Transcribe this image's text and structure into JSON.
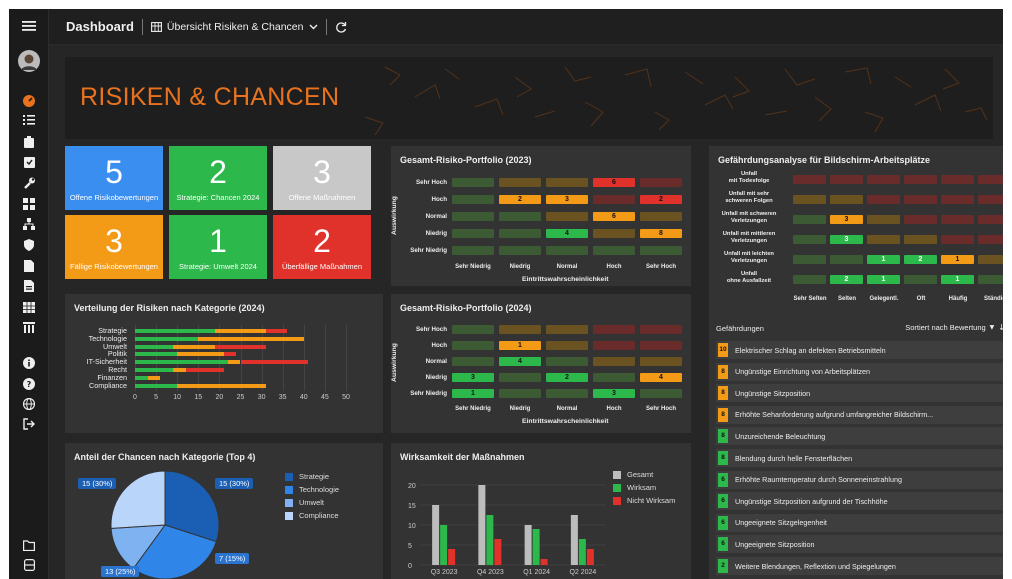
{
  "topbar": {
    "title": "Dashboard",
    "view_label": "Übersicht Risiken & Chancen"
  },
  "banner": {
    "title": "RISIKEN & CHANCEN"
  },
  "kpis": [
    {
      "value": "5",
      "label": "Offene Risikobewertungen",
      "color": "#3a8ef0"
    },
    {
      "value": "2",
      "label": "Strategie: Chancen 2024",
      "color": "#2db84b"
    },
    {
      "value": "3",
      "label": "Offene Maßnahmen",
      "color": "#c8c8c8"
    },
    {
      "value": "3",
      "label": "Fällige Risikobewertungen",
      "color": "#f39a16"
    },
    {
      "value": "1",
      "label": "Strategie: Umwelt 2024",
      "color": "#2db84b"
    },
    {
      "value": "2",
      "label": "Überfällige Maßnahmen",
      "color": "#e0312b"
    }
  ],
  "portfolio2023": {
    "title": "Gesamt-Risiko-Portfolio (2023)",
    "y_title": "Auswirkung",
    "x_title": "Eintrittswahrscheinlichkeit",
    "rows": [
      "Sehr Hoch",
      "Hoch",
      "Normal",
      "Niedrig",
      "Sehr Niedrig"
    ],
    "cols": [
      "Sehr Niedrig",
      "Niedrig",
      "Normal",
      "Hoch",
      "Sehr Hoch"
    ],
    "grid": [
      [
        {
          "v": "",
          "c": "#3c5a33"
        },
        {
          "v": "",
          "c": "#6a5320"
        },
        {
          "v": "",
          "c": "#6a5320"
        },
        {
          "v": "6",
          "c": "#e0312b"
        },
        {
          "v": "",
          "c": "#6a2c2a"
        }
      ],
      [
        {
          "v": "",
          "c": "#3c5a33"
        },
        {
          "v": "2",
          "c": "#f39a16"
        },
        {
          "v": "3",
          "c": "#f39a16"
        },
        {
          "v": "",
          "c": "#6a2c2a"
        },
        {
          "v": "2",
          "c": "#e0312b"
        }
      ],
      [
        {
          "v": "",
          "c": "#3c5a33"
        },
        {
          "v": "",
          "c": "#3c5a33"
        },
        {
          "v": "",
          "c": "#6a5320"
        },
        {
          "v": "6",
          "c": "#f39a16"
        },
        {
          "v": "",
          "c": "#6a5320"
        }
      ],
      [
        {
          "v": "",
          "c": "#3c5a33"
        },
        {
          "v": "",
          "c": "#3c5a33"
        },
        {
          "v": "4",
          "c": "#2db84b"
        },
        {
          "v": "",
          "c": "#6a5320"
        },
        {
          "v": "8",
          "c": "#f39a16"
        }
      ],
      [
        {
          "v": "",
          "c": "#3c5a33"
        },
        {
          "v": "",
          "c": "#3c5a33"
        },
        {
          "v": "",
          "c": "#3c5a33"
        },
        {
          "v": "",
          "c": "#3c5a33"
        },
        {
          "v": "",
          "c": "#3c5a33"
        }
      ]
    ]
  },
  "portfolio2024": {
    "title": "Gesamt-Risiko-Portfolio (2024)",
    "y_title": "Auswirkung",
    "x_title": "Eintrittswahrscheinlichkeit",
    "rows": [
      "Sehr Hoch",
      "Hoch",
      "Normal",
      "Niedrig",
      "Sehr Niedrig"
    ],
    "cols": [
      "Sehr Niedrig",
      "Niedrig",
      "Normal",
      "Hoch",
      "Sehr Hoch"
    ],
    "grid": [
      [
        {
          "v": "",
          "c": "#3c5a33"
        },
        {
          "v": "",
          "c": "#6a5320"
        },
        {
          "v": "",
          "c": "#6a5320"
        },
        {
          "v": "",
          "c": "#6a2c2a"
        },
        {
          "v": "",
          "c": "#6a2c2a"
        }
      ],
      [
        {
          "v": "",
          "c": "#3c5a33"
        },
        {
          "v": "1",
          "c": "#f39a16"
        },
        {
          "v": "",
          "c": "#6a5320"
        },
        {
          "v": "",
          "c": "#6a2c2a"
        },
        {
          "v": "",
          "c": "#6a2c2a"
        }
      ],
      [
        {
          "v": "",
          "c": "#3c5a33"
        },
        {
          "v": "4",
          "c": "#2db84b"
        },
        {
          "v": "",
          "c": "#3c5a33"
        },
        {
          "v": "",
          "c": "#6a5320"
        },
        {
          "v": "",
          "c": "#6a5320"
        }
      ],
      [
        {
          "v": "3",
          "c": "#2db84b"
        },
        {
          "v": "",
          "c": "#3c5a33"
        },
        {
          "v": "2",
          "c": "#2db84b"
        },
        {
          "v": "",
          "c": "#3c5a33"
        },
        {
          "v": "4",
          "c": "#f39a16"
        }
      ],
      [
        {
          "v": "1",
          "c": "#2db84b"
        },
        {
          "v": "",
          "c": "#3c5a33"
        },
        {
          "v": "",
          "c": "#3c5a33"
        },
        {
          "v": "3",
          "c": "#2db84b"
        },
        {
          "v": "",
          "c": "#3c5a33"
        }
      ]
    ]
  },
  "hazard": {
    "title": "Gefährdungsanalyse für Bildschirm-Arbeitsplätze",
    "rows": [
      "Unfall\nmit Todesfolge",
      "Unfall mit sehr\nschweren Folgen",
      "Unfall mit schweren\nVerletzungen",
      "Unfall mit mittleren\nVerletzungen",
      "Unfall mit leichten\nVerletzungen",
      "Unfall\nohne Ausfallzeit"
    ],
    "cols": [
      "Sehr Selten",
      "Selten",
      "Gelegentl.",
      "Oft",
      "Häufig",
      "Ständig"
    ],
    "grid": [
      [
        {
          "v": "",
          "c": "#6a2c2a"
        },
        {
          "v": "",
          "c": "#6a2c2a"
        },
        {
          "v": "",
          "c": "#6a2c2a"
        },
        {
          "v": "",
          "c": "#6a2c2a"
        },
        {
          "v": "",
          "c": "#6a2c2a"
        },
        {
          "v": "",
          "c": "#6a2c2a"
        }
      ],
      [
        {
          "v": "",
          "c": "#6a5320"
        },
        {
          "v": "",
          "c": "#6a5320"
        },
        {
          "v": "",
          "c": "#6a2c2a"
        },
        {
          "v": "",
          "c": "#6a2c2a"
        },
        {
          "v": "",
          "c": "#6a2c2a"
        },
        {
          "v": "",
          "c": "#6a2c2a"
        }
      ],
      [
        {
          "v": "",
          "c": "#3c5a33"
        },
        {
          "v": "3",
          "c": "#f39a16"
        },
        {
          "v": "",
          "c": "#6a5320"
        },
        {
          "v": "",
          "c": "#6a2c2a"
        },
        {
          "v": "",
          "c": "#6a2c2a"
        },
        {
          "v": "",
          "c": "#6a2c2a"
        }
      ],
      [
        {
          "v": "",
          "c": "#3c5a33"
        },
        {
          "v": "3",
          "c": "#2db84b"
        },
        {
          "v": "",
          "c": "#6a5320"
        },
        {
          "v": "",
          "c": "#6a5320"
        },
        {
          "v": "",
          "c": "#6a2c2a"
        },
        {
          "v": "",
          "c": "#6a2c2a"
        }
      ],
      [
        {
          "v": "",
          "c": "#3c5a33"
        },
        {
          "v": "",
          "c": "#3c5a33"
        },
        {
          "v": "1",
          "c": "#2db84b"
        },
        {
          "v": "2",
          "c": "#2db84b"
        },
        {
          "v": "1",
          "c": "#f39a16"
        },
        {
          "v": "",
          "c": "#6a5320"
        }
      ],
      [
        {
          "v": "",
          "c": "#3c5a33"
        },
        {
          "v": "2",
          "c": "#2db84b"
        },
        {
          "v": "1",
          "c": "#2db84b"
        },
        {
          "v": "",
          "c": "#3c5a33"
        },
        {
          "v": "1",
          "c": "#2db84b"
        },
        {
          "v": "",
          "c": "#3c5a33"
        }
      ]
    ]
  },
  "hazards_list": {
    "title": "Gefährdungen",
    "sort_label": "Sortiert nach Bewertung",
    "items": [
      {
        "score": "10",
        "label": "Elektrischer Schlag an defekten Betriebsmitteln",
        "color": "#f39a16"
      },
      {
        "score": "8",
        "label": "Ungünstige Einrichtung von Arbeitsplätzen",
        "color": "#f39a16"
      },
      {
        "score": "8",
        "label": "Ungünstige Sitzposition",
        "color": "#f39a16"
      },
      {
        "score": "8",
        "label": "Erhöhte Sehanforderung aufgrund umfangreicher Bildschirm...",
        "color": "#f39a16"
      },
      {
        "score": "8",
        "label": "Unzureichende Beleuchtung",
        "color": "#2db84b"
      },
      {
        "score": "8",
        "label": "Blendung durch helle Fensterflächen",
        "color": "#2db84b"
      },
      {
        "score": "6",
        "label": "Erhöhte Raumtemperatur durch Sonneneinstrahlung",
        "color": "#2db84b"
      },
      {
        "score": "6",
        "label": "Ungünstige Sitzposition aufgrund der Tischhöhe",
        "color": "#2db84b"
      },
      {
        "score": "6",
        "label": "Ungeeignete Sitzgelegenheit",
        "color": "#2db84b"
      },
      {
        "score": "6",
        "label": "Ungeeignete Sitzposition",
        "color": "#2db84b"
      },
      {
        "score": "2",
        "label": "Weitere Blendungen, Reflextion und Spiegelungen",
        "color": "#2db84b"
      }
    ]
  },
  "chart_data": [
    {
      "type": "bar",
      "orientation": "horizontal",
      "stacked": true,
      "title": "Verteilung der Risiken nach Kategorie (2024)",
      "categories": [
        "Strategie",
        "Technologie",
        "Umwelt",
        "Politik",
        "IT-Sicherheit",
        "Recht",
        "Finanzen",
        "Compliance"
      ],
      "series": [
        {
          "color": "#2db84b",
          "values": [
            19,
            15,
            9,
            10,
            22,
            9,
            3,
            10
          ]
        },
        {
          "color": "#f39a16",
          "values": [
            12,
            25,
            10,
            11,
            3,
            3,
            3,
            21
          ]
        },
        {
          "color": "#e0312b",
          "values": [
            5,
            0,
            12,
            3,
            16,
            9,
            0,
            0
          ]
        }
      ],
      "xticks": [
        0,
        5,
        10,
        15,
        20,
        25,
        30,
        35,
        40,
        45,
        50
      ],
      "xlim": [
        0,
        50
      ],
      "grid": true
    },
    {
      "type": "pie",
      "title": "Anteil der Chancen nach Kategorie (Top 4)",
      "slices": [
        {
          "name": "Strategie",
          "value": 15,
          "label": "15 (30%)",
          "color": "#1a5fb4"
        },
        {
          "name": "Technologie",
          "value": 15,
          "label": "15 (30%)",
          "color": "#2f86e8"
        },
        {
          "name": "Umwelt",
          "value": 7,
          "label": "7 (15%)",
          "color": "#7fb2f0"
        },
        {
          "name": "Compliance",
          "value": 13,
          "label": "13 (25%)",
          "color": "#b9d6fa"
        }
      ],
      "legend": "right"
    },
    {
      "type": "bar",
      "title": "Wirksamkeit der Maßnahmen",
      "categories": [
        "Q3 2023",
        "Q4 2023",
        "Q1 2024",
        "Q2 2024"
      ],
      "series": [
        {
          "name": "Gesamt",
          "color": "#bdbdbd",
          "values": [
            15,
            20,
            10,
            12.5
          ]
        },
        {
          "name": "Wirksam",
          "color": "#2db84b",
          "values": [
            10,
            12.5,
            9,
            6.5
          ]
        },
        {
          "name": "Nicht Wirksam",
          "color": "#e0312b",
          "values": [
            4,
            6.5,
            1.5,
            4
          ]
        }
      ],
      "yticks": [
        0,
        5,
        10,
        15,
        20
      ],
      "ylim": [
        0,
        22
      ],
      "legend": "top-right"
    }
  ]
}
